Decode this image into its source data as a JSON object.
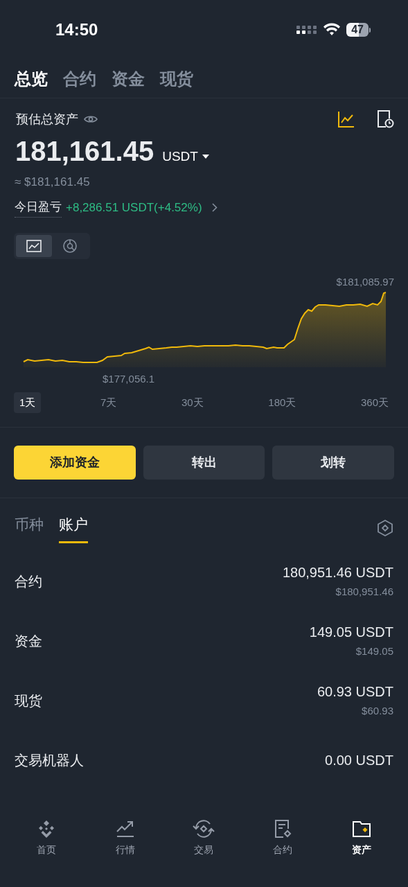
{
  "status_bar": {
    "time": "14:50",
    "battery": "47"
  },
  "tabs": [
    {
      "label": "总览",
      "selected": true
    },
    {
      "label": "合约",
      "selected": false
    },
    {
      "label": "资金",
      "selected": false
    },
    {
      "label": "现货",
      "selected": false
    }
  ],
  "summary": {
    "label": "预估总资产",
    "amount": "181,161.45",
    "currency": "USDT",
    "approx": "≈ $181,161.45",
    "pnl_label": "今日盈亏",
    "pnl_value": "+8,286.51 USDT(+4.52%)"
  },
  "chart_toggle": [
    {
      "kind": "line",
      "selected": true
    },
    {
      "kind": "pie",
      "selected": false
    }
  ],
  "chart": {
    "max_label": "$181,085.97",
    "min_label": "$177,056.1"
  },
  "ranges": [
    {
      "label": "1天",
      "selected": true
    },
    {
      "label": "7天",
      "selected": false
    },
    {
      "label": "30天",
      "selected": false
    },
    {
      "label": "180天",
      "selected": false
    },
    {
      "label": "360天",
      "selected": false
    }
  ],
  "actions": [
    {
      "label": "添加资金",
      "kind": "primary"
    },
    {
      "label": "转出",
      "kind": "secondary"
    },
    {
      "label": "划转",
      "kind": "secondary"
    }
  ],
  "list_tabs": [
    {
      "label": "币种",
      "selected": false
    },
    {
      "label": "账户",
      "selected": true
    }
  ],
  "accounts": [
    {
      "name": "合约",
      "amount": "180,951.46 USDT",
      "usd": "$180,951.46"
    },
    {
      "name": "资金",
      "amount": "149.05 USDT",
      "usd": "$149.05"
    },
    {
      "name": "现货",
      "amount": "60.93 USDT",
      "usd": "$60.93"
    },
    {
      "name": "交易机器人",
      "amount": "0.00 USDT"
    }
  ],
  "nav": [
    {
      "label": "首页",
      "kind": "home",
      "selected": false
    },
    {
      "label": "行情",
      "kind": "markets",
      "selected": false
    },
    {
      "label": "交易",
      "kind": "trade",
      "selected": false
    },
    {
      "label": "合约",
      "kind": "futures",
      "selected": false
    },
    {
      "label": "资产",
      "kind": "assets",
      "selected": true
    }
  ]
}
